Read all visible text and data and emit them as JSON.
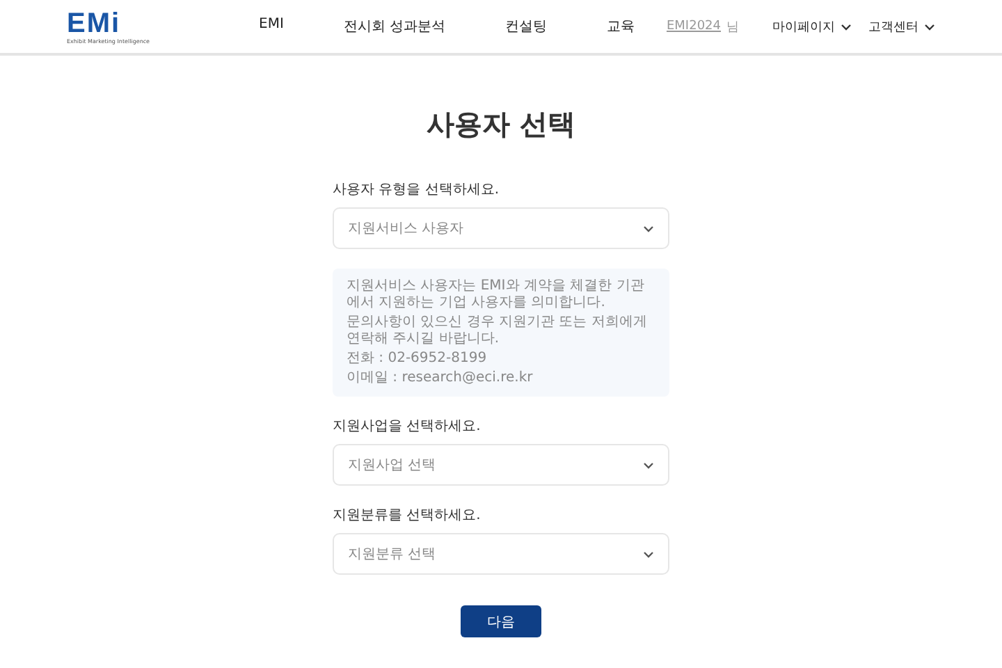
{
  "header": {
    "logo": {
      "mark": "EMi",
      "tagline": "Exhibit Marketing Intelligence"
    },
    "nav": [
      "EMI",
      "전시회 성과분석",
      "컨설팅",
      "교육"
    ],
    "user": {
      "name": "EMI2024",
      "suffix": "님"
    },
    "menus": [
      {
        "label": "마이페이지",
        "expanded": false
      },
      {
        "label": "고객센터",
        "expanded": false
      }
    ]
  },
  "title": "사용자 선택",
  "fields": [
    {
      "label": "사용자 유형을 선택하세요.",
      "value": "지원서비스 사용자",
      "info": [
        "지원서비스 사용자는 EMI와 계약을 체결한 기관에서 지원하는 기업 사용자를 의미합니다.",
        "문의사항이 있으신 경우 지원기관 또는 저희에게 연락해 주시길 바랍니다.",
        "전화 : 02-6952-8199",
        "이메일 : research@eci.re.kr"
      ]
    },
    {
      "label": "지원사업을 선택하세요.",
      "value": "지원사업 선택"
    },
    {
      "label": "지원분류를 선택하세요.",
      "value": "지원분류 선택"
    }
  ],
  "next_button": "다음"
}
